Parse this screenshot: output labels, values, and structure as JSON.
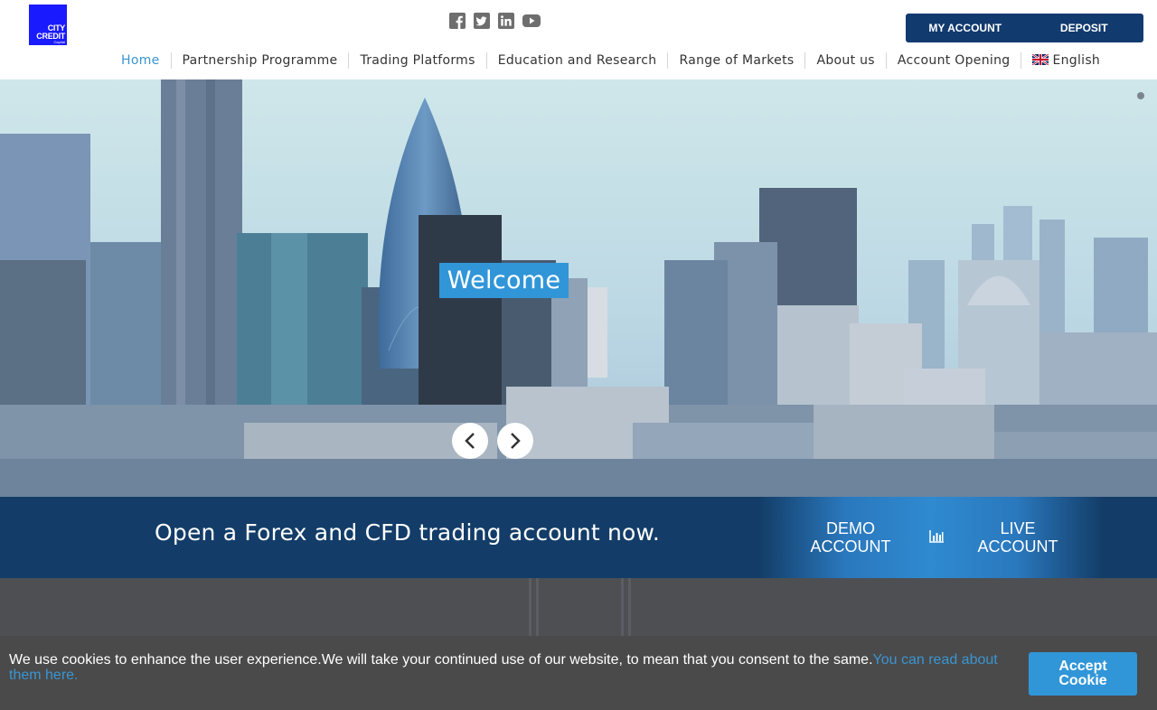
{
  "logo": {
    "line1": "CITY",
    "line2": "CREDIT",
    "line3": "Capital"
  },
  "social": [
    "facebook-icon",
    "twitter-icon",
    "linkedin-icon",
    "youtube-icon"
  ],
  "account_bar": {
    "my_account": "MY ACCOUNT",
    "deposit": "DEPOSIT"
  },
  "nav": {
    "items": [
      "Home",
      "Partnership Programme",
      "Trading Platforms",
      "Education and Research",
      "Range of Markets",
      "About us",
      "Account Opening"
    ],
    "language": "English"
  },
  "hero": {
    "caption": "Welcome"
  },
  "cta": {
    "headline": "Open a Forex and CFD trading account now.",
    "demo_line1": "DEMO",
    "demo_line2": "ACCOUNT",
    "live_line1": "LIVE",
    "live_line2": "ACCOUNT"
  },
  "cookie": {
    "message": "We use cookies to enhance the user experience.We will take your continued use of our website, to mean that you consent to the same.",
    "link": "You can read about them here.",
    "button_line1": "Accept",
    "button_line2": "Cookie"
  },
  "colors": {
    "brand_navy": "#113a6e",
    "accent_blue": "#3196d8",
    "link_blue": "#3b95d2",
    "logo_blue": "#1a1aff"
  }
}
